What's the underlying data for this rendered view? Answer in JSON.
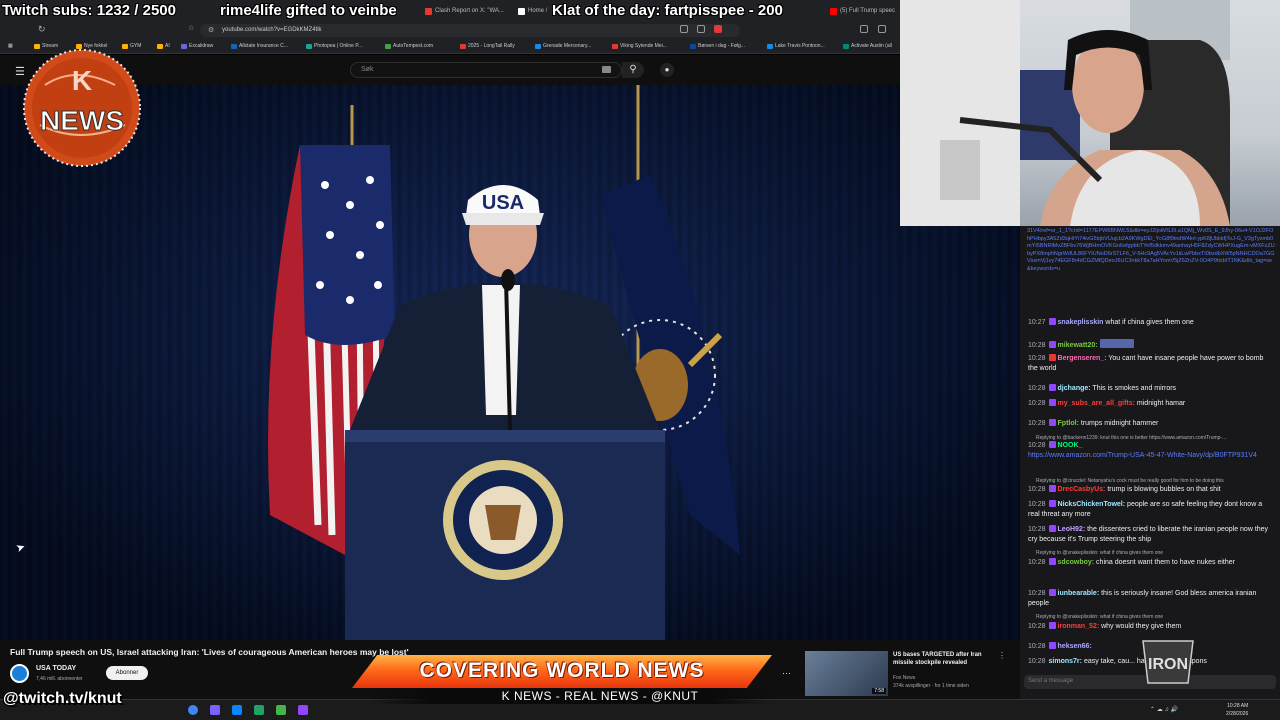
{
  "overlay": {
    "ticker": [
      "Twitch subs: 1232 / 2500",
      "rime4life gifted to veinbe",
      "Klat of the day: fartpisspee - 200"
    ],
    "logo_text": "NEWS",
    "logo_letter": "K",
    "handle": "@twitch.tv/knut",
    "banner": "COVERING WORLD NEWS",
    "subbanner": "K NEWS - REAL NEWS - @KNUT",
    "team_logo_text": "IRON"
  },
  "browser": {
    "tabs": [
      {
        "label": "Clash Report on X: \"WA...",
        "color": "#e53935"
      },
      {
        "label": "Home /",
        "color": "#ffffff"
      },
      {
        "label": "(5) Full Trump speec",
        "color": "#ff0000"
      }
    ],
    "url": "youtube.com/watch?v=EGDkKMZ4tlk",
    "bookmarks": [
      {
        "label": "Stream",
        "color": "#ffb300"
      },
      {
        "label": "Nye fokkel",
        "color": "#ffb300"
      },
      {
        "label": "GYM",
        "color": "#ffb300"
      },
      {
        "label": "AI",
        "color": "#ffb300"
      },
      {
        "label": "Excalidraw",
        "color": "#6965db"
      },
      {
        "label": "Allstate Insurance C...",
        "color": "#1565c0"
      },
      {
        "label": "Photopea | Online P...",
        "color": "#18a497"
      },
      {
        "label": "AutoTempest.com",
        "color": "#43a047"
      },
      {
        "label": "2025 - LongTail Rally",
        "color": "#e53935"
      },
      {
        "label": "Grenade Mercenary...",
        "color": "#1e88e5"
      },
      {
        "label": "Viking Sytende Mei...",
        "color": "#e53935"
      },
      {
        "label": "Børsen i dag - Følg...",
        "color": "#0d47a1"
      },
      {
        "label": "Lake Travis Pontoon...",
        "color": "#1e88e5"
      },
      {
        "label": "Activate Austin (all",
        "color": "#00897b"
      }
    ]
  },
  "youtube": {
    "search_placeholder": "Søk",
    "video_title": "Full Trump speech on US, Israel attacking Iran: 'Lives of courageous American heroes may be lost'",
    "channel_name": "USA TODAY",
    "channel_subs": "7,46 mill. abonnenter",
    "subscribe_label": "Abonner",
    "hat_text": "USA",
    "related": {
      "title": "US bases TARGETED after Iran missile stockpile revealed",
      "channel": "Fox News",
      "meta": "374k avspillinger · for 1 time siden",
      "duration": "7:58"
    }
  },
  "chat": {
    "link_block": "31V4/ref=sr_1_1?crid=1177EPW6BNWL5&dib=eyJ2IjoiMSJ9.a1QMj_Wv0S_E_9Jhy-06u4-V1OJ2FOhPHbpy3A5Zd3qHtYi74ivG5tqbVUujcb2A9KWgDEl_YcG8f9tndW4krl-ypK8jUbkkfjToJ-G_V3gTyxmb0mYI5BNRlMvZBFbv76WjBHmOVKGn6efgpbbTYef5dkkmv49anhayH5F8ZdyCWHPXugEm-vMXFzZUbyPX8mphNgrWdUL86FYIUNoD6rSTLF6_V-5Hc9Ag5VAcYv1iiLwPbbxTI0bzdbXW5pNNHCDOa7GGVssmVj1vy74EGF8r4dCGZMfQDeoJ6UC3nkkT8a7aHYomV5jZ6ZnZV-0O4P9ttzbIT1NK&dib_tag=se&keywords=u",
    "input_placeholder": "Send a message",
    "messages": [
      {
        "ts": "10:27",
        "nick": "snakeplisskin",
        "color": "#a9a9ff",
        "text": "what if china gives them one"
      },
      {
        "ts": "10:28",
        "nick": "mikewatt20:",
        "color": "#7ac943",
        "text": ""
      },
      {
        "ts": "10:28",
        "nick": "Bergenseren_:",
        "color": "#ff69b4",
        "text": "You cant have insane people have power to bomb the world"
      },
      {
        "ts": "10:28",
        "nick": "djchange:",
        "color": "#a0e8ff",
        "text": "This is smokes and mirrors"
      },
      {
        "ts": "10:28",
        "nick": "my_subs_are_all_gifts:",
        "color": "#ff3b3b",
        "text": "midnight hamar"
      },
      {
        "ts": "10:28",
        "nick": "Fptlol:",
        "color": "#7ac943",
        "text": "trumps midnight hammer"
      },
      {
        "reply": "Replying to @backenn1239: knut this one is better https://www.amazon.com/Trump-..."
      },
      {
        "ts": "10:28",
        "nick": "NOOK_",
        "color": "#00ff7f",
        "text": "",
        "link": "https://www.amazon.com/Trump-USA-45-47-White-Navy/dp/B0FTP931V4"
      },
      {
        "reply": "Replying to @cirucdel: Netanyahu's cock must be really good for him to be doing this"
      },
      {
        "ts": "10:28",
        "nick": "DrecCasbyUs:",
        "color": "#ff3b3b",
        "text": "trump is blowing bubbles on that shit"
      },
      {
        "ts": "10:28",
        "nick": "NicksChickenTowel:",
        "color": "#a0e8ff",
        "text": "people are so safe feeling they dont know a real threat any more"
      },
      {
        "ts": "10:28",
        "nick": "LeoH92:",
        "color": "#c8a0ff",
        "text": "the dissenters cried to liberate the iranian people now they cry because it's Trump steering the ship"
      },
      {
        "reply": "Replying to @snakeplisskin: what if china gives them one"
      },
      {
        "ts": "10:28",
        "nick": "sdcowboy:",
        "color": "#7ac943",
        "text": "china doesnt want them to have nukes either"
      },
      {
        "ts": "10:28",
        "nick": "iunbearable:",
        "color": "#a0e8ff",
        "text": "this is seriously insane! God bless america iranian people"
      },
      {
        "reply": "Replying to @snakeplisskin: what if china gives them one"
      },
      {
        "ts": "10:28",
        "nick": "ironman_52:",
        "color": "#ff3b3b",
        "text": "why would they give them"
      },
      {
        "ts": "10:28",
        "nick": "heksen66:",
        "color": "#a9a9ff",
        "text": ""
      },
      {
        "ts": "10:28",
        "nick": "simons7r:",
        "color": "#a0e8ff",
        "text": "easy take, cau... have nuclear weapons"
      }
    ]
  },
  "taskbar": {
    "time": "10:28 AM",
    "date": "2/28/2026"
  }
}
